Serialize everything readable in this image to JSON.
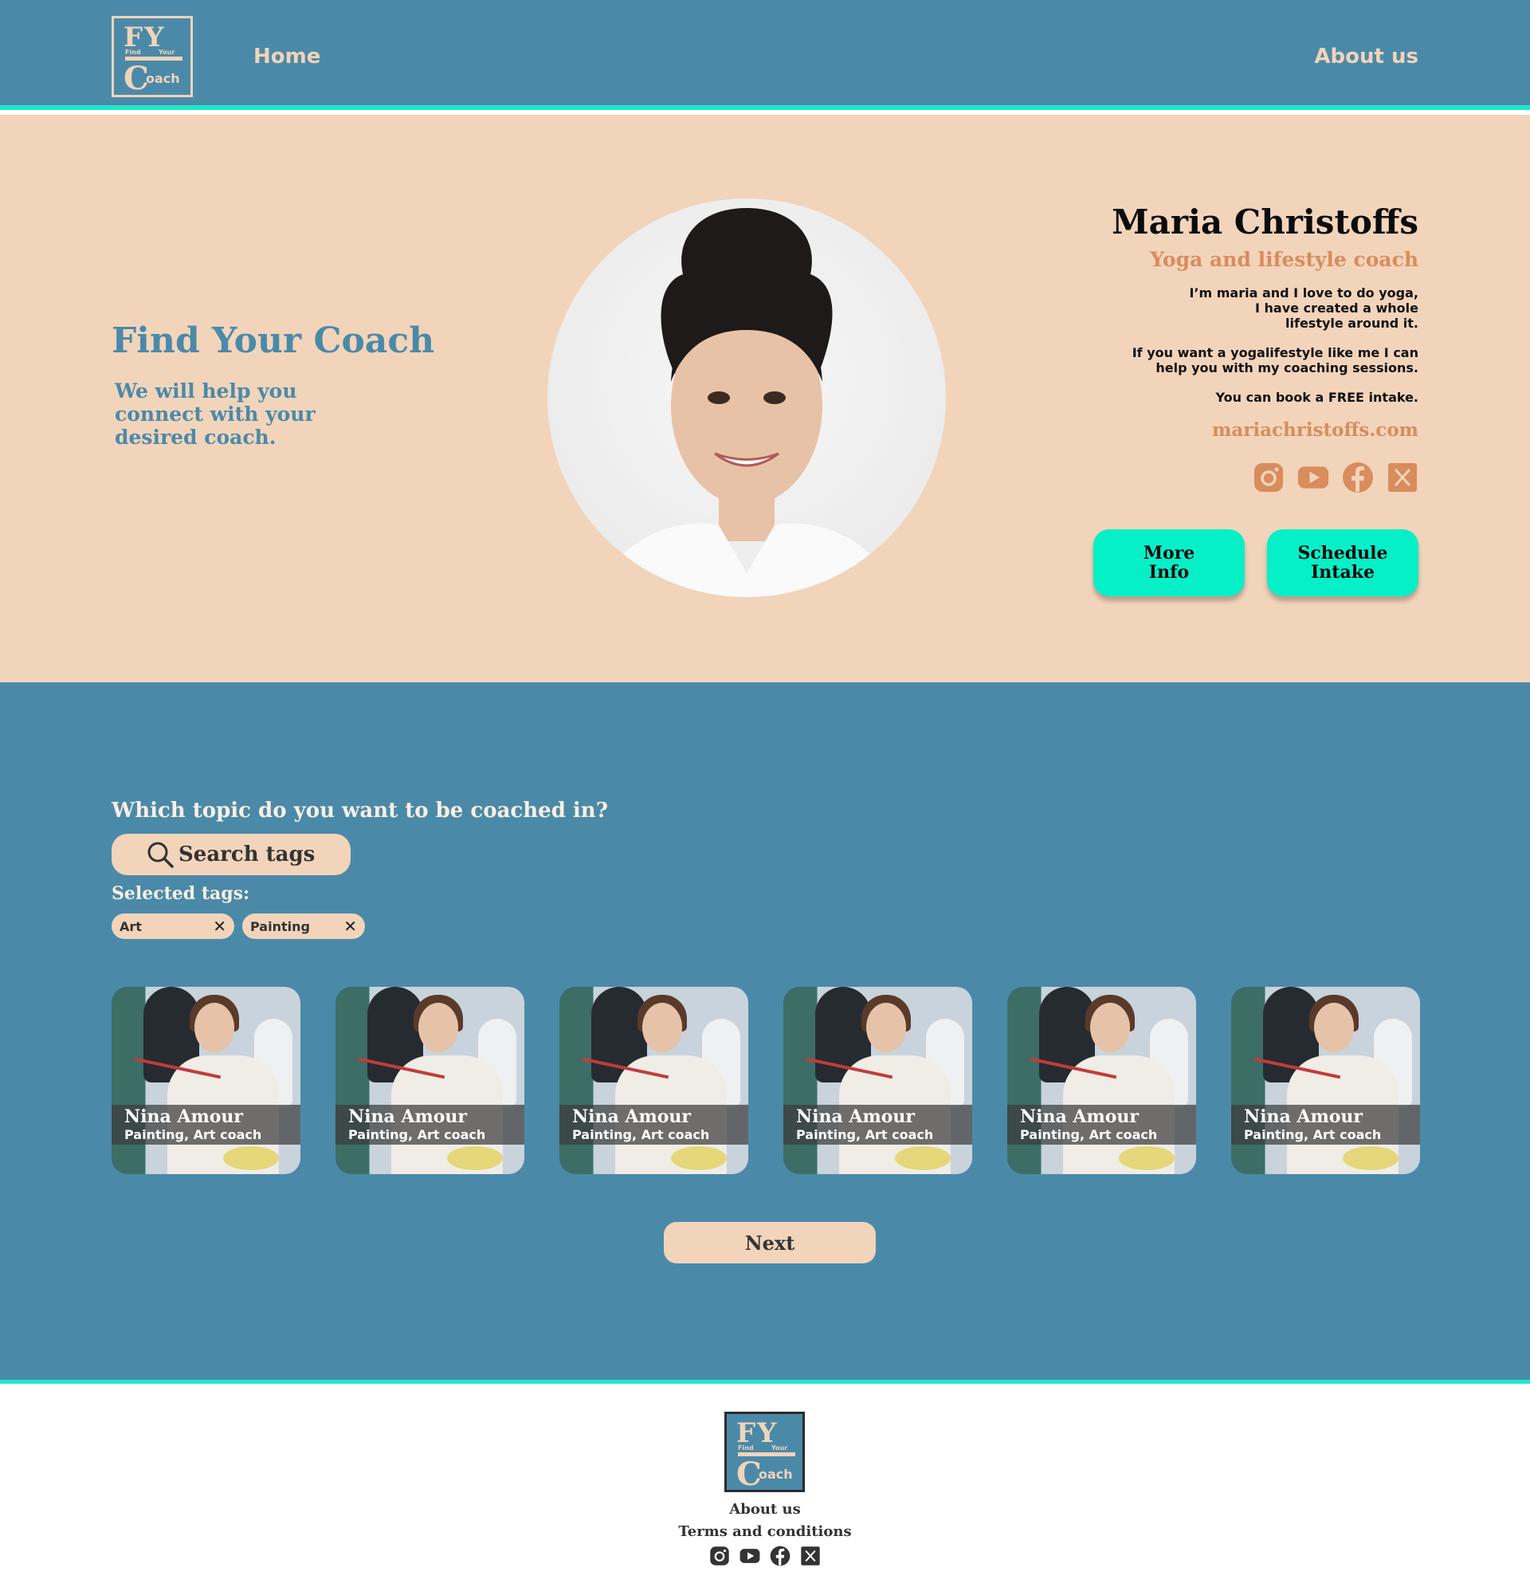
{
  "brand": {
    "logo_initials": "FY",
    "logo_find": "Find",
    "logo_your": "Your",
    "logo_c": "C",
    "logo_oach": "oach"
  },
  "nav": {
    "home": "Home",
    "about": "About us"
  },
  "hero": {
    "title": "Find Your Coach",
    "subtitle": "We will help you connect with your desired coach."
  },
  "featured_coach": {
    "name": "Maria Christoffs",
    "role": "Yoga and lifestyle coach",
    "desc1": "I’m maria and I love to do yoga,\nI have created a whole\nlifestyle around it.",
    "desc2": "If you want a yogalifestyle like me I can\nhelp you with my coaching sessions.",
    "desc3": "You can book a FREE intake.",
    "website": "mariachristoffs.com",
    "more_info": "More\nInfo",
    "schedule": "Schedule\nIntake",
    "social_icons": [
      "instagram-icon",
      "youtube-icon",
      "facebook-icon",
      "x-icon"
    ]
  },
  "topics": {
    "question": "Which topic do you want to be coached in?",
    "search_placeholder": "Search tags",
    "selected_label": "Selected tags:",
    "tags": [
      "Art",
      "Painting"
    ],
    "cards": [
      {
        "name": "Nina Amour",
        "tags": "Painting, Art coach"
      },
      {
        "name": "Nina Amour",
        "tags": "Painting, Art coach"
      },
      {
        "name": "Nina Amour",
        "tags": "Painting, Art coach"
      },
      {
        "name": "Nina Amour",
        "tags": "Painting, Art coach"
      },
      {
        "name": "Nina Amour",
        "tags": "Painting, Art coach"
      },
      {
        "name": "Nina Amour",
        "tags": "Painting, Art coach"
      }
    ],
    "next": "Next"
  },
  "footer": {
    "about": "About us",
    "terms": "Terms and conditions"
  },
  "colors": {
    "teal_blue": "#4a8aa8",
    "peach": "#f2d4bb",
    "accent_mint": "#06f0c8",
    "orange": "#d98c5c"
  }
}
